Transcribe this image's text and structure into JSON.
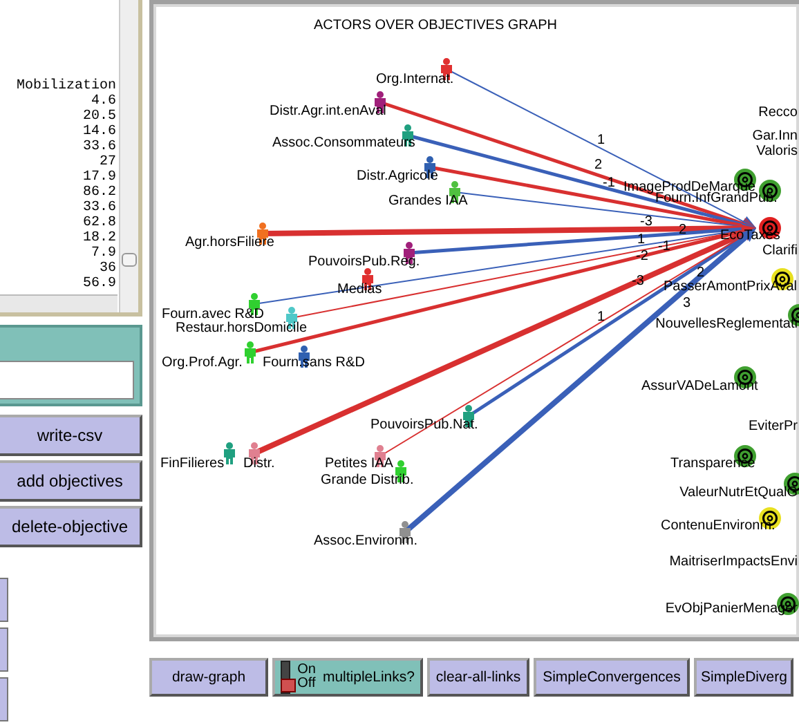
{
  "output": {
    "header": "Mobilization",
    "values": [
      "4.6",
      "20.5",
      "14.6",
      "33.6",
      "27",
      "17.9",
      "86.2",
      "33.6",
      "62.8",
      "18.2",
      "7.9",
      "36",
      "56.9"
    ]
  },
  "buttons": [
    "write-csv",
    "add objectives",
    "delete-objective"
  ],
  "graph": {
    "title": "ACTORS OVER OBJECTIVES GRAPH",
    "actors": [
      {
        "name": "Org.Internat.",
        "color": "#e03030",
        "link": {
          "kind": "thin-blue",
          "label": "1"
        }
      },
      {
        "name": "Distr.Agr.int.enAval",
        "color": "#a0207a",
        "link": {
          "kind": "medium-red",
          "label": "2"
        }
      },
      {
        "name": "Assoc.Consommateurs",
        "color": "#20a080",
        "link": {
          "kind": "medium-blue",
          "label": "-1"
        }
      },
      {
        "name": "Distr.Agricole",
        "color": "#3060b0",
        "link": {
          "kind": "medium-red"
        }
      },
      {
        "name": "Grandes IAA",
        "color": "#50c040",
        "link": {
          "kind": "thin-blue"
        }
      },
      {
        "name": "Agr.horsFiliere",
        "color": "#f07020",
        "link": {
          "kind": "thick-red",
          "label": "-3"
        }
      },
      {
        "name": "PouvoirsPub.Reg.",
        "color": "#a0207a",
        "link": {
          "kind": "medium-blue",
          "label": "2"
        }
      },
      {
        "name": "Medias",
        "color": "#e03030"
      },
      {
        "name": "Fourn.avec R&D",
        "color": "#30d030",
        "link": {
          "kind": "thin-blue",
          "label": "1"
        }
      },
      {
        "name": "Restaur.horsDomicile",
        "color": "#50c8c8",
        "link": {
          "kind": "thin-red",
          "label": "-1"
        }
      },
      {
        "name": "Org.Prof.Agr.",
        "color": "#30d030",
        "link": {
          "kind": "medium-red",
          "label": "-2"
        }
      },
      {
        "name": "Fourn.sans R&D",
        "color": "#3060b0"
      },
      {
        "name": "FinFilieres",
        "color": "#20a080"
      },
      {
        "name": "Distr.",
        "color": "#e08090",
        "link": {
          "kind": "thick-red",
          "label": "-3"
        }
      },
      {
        "name": "PouvoirsPub.Nat.",
        "color": "#20a080",
        "link": {
          "kind": "medium-blue",
          "label": "2"
        }
      },
      {
        "name": "Petites IAA",
        "color": "#e08090",
        "link": {
          "kind": "thin-red",
          "label": "1"
        }
      },
      {
        "name": "Grande Distrib.",
        "color": "#30d030"
      },
      {
        "name": "Assoc.Environm.",
        "color": "#909090",
        "link": {
          "kind": "thick-blue",
          "label": "3"
        }
      }
    ],
    "objectives": [
      {
        "name": "Recco"
      },
      {
        "name": "Gar.Inn"
      },
      {
        "name": "Valoris"
      },
      {
        "name": "ImageProdDeMarque",
        "color": "#40a030"
      },
      {
        "name": "Fourn.InfGrandPub.",
        "color": "#40a030"
      },
      {
        "name": "EcoTaxes",
        "color": "#e02020"
      },
      {
        "name": "Clarifi"
      },
      {
        "name": "PasserAmontPrixAval",
        "color": "#e8e020"
      },
      {
        "name": "NouvellesReglementati",
        "color": "#40a030"
      },
      {
        "name": "AssurVADeLamont",
        "color": "#40a030"
      },
      {
        "name": "EviterPr"
      },
      {
        "name": "Transparence",
        "color": "#40a030"
      },
      {
        "name": "ValeurNutrEtQualG",
        "color": "#40a030"
      },
      {
        "name": "ContenuEnvironm.",
        "color": "#e8e020"
      },
      {
        "name": "MaitriserImpactsEnvi"
      },
      {
        "name": "EvObjPanierMenager",
        "color": "#40a030"
      }
    ]
  },
  "bottom_controls": [
    {
      "kind": "button",
      "label": "draw-graph"
    },
    {
      "kind": "switch",
      "label": "multipleLinks?",
      "on_label": "On",
      "off_label": "Off",
      "on": false
    },
    {
      "kind": "button",
      "label": "clear-all-links"
    },
    {
      "kind": "button",
      "label": "SimpleConvergences"
    },
    {
      "kind": "button",
      "label": "SimpleDiverg"
    }
  ]
}
